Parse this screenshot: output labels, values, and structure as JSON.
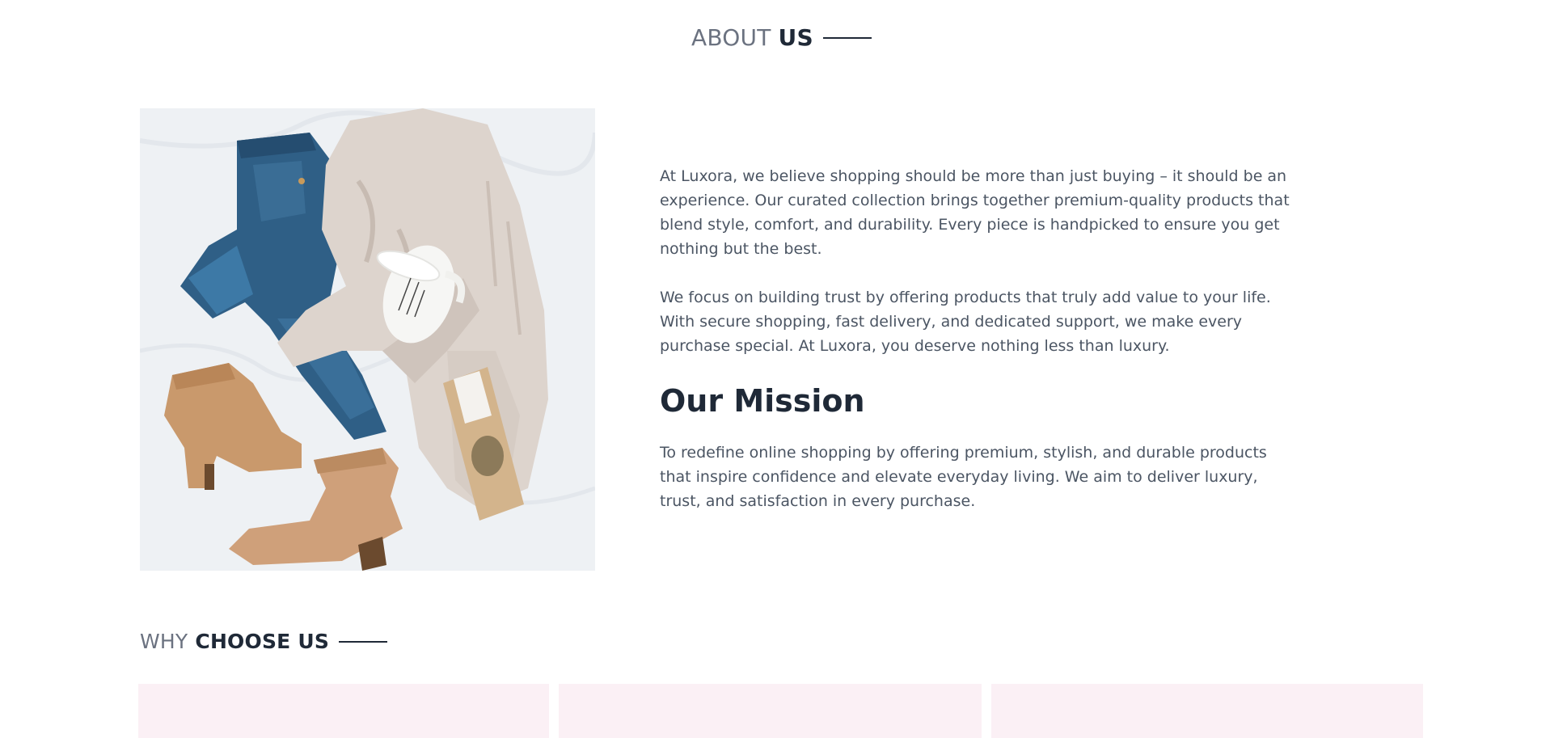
{
  "about": {
    "title_light": "ABOUT",
    "title_bold": "US",
    "image_alt": "Flat lay of jeans, knit cardigan, mug, tea bag and suede boots",
    "paragraphs": [
      "At Luxora, we believe shopping should be more than just buying – it should be an experience. Our curated collection brings together premium-quality products that blend style, comfort, and durability. Every piece is handpicked to ensure you get nothing but the best.",
      "We focus on building trust by offering products that truly add value to your life. With secure shopping, fast delivery, and dedicated support, we make every purchase special. At Luxora, you deserve nothing less than luxury."
    ],
    "mission_heading": "Our Mission",
    "mission_text": "To redefine online shopping by offering premium, stylish, and durable products that inspire confidence and elevate everyday living. We aim to deliver luxury, trust, and satisfaction in every purchase."
  },
  "why": {
    "title_light": "WHY",
    "title_bold": "CHOOSE US"
  },
  "colors": {
    "heading_dark": "#1f2937",
    "text_gray": "#4b5563",
    "card_bg": "#fbf0f5"
  }
}
